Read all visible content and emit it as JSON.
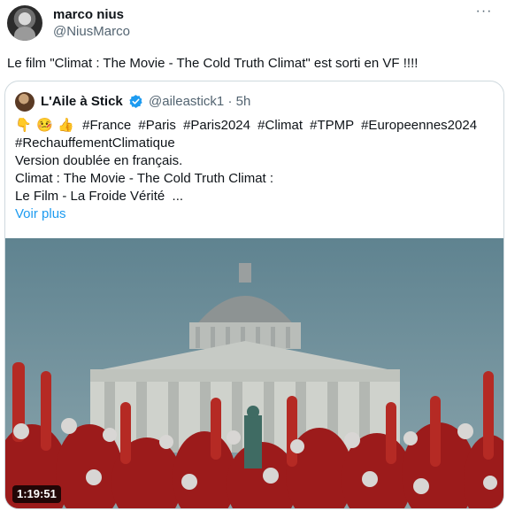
{
  "tweet": {
    "author_name": "marco nius",
    "author_handle": "@NiusMarco",
    "more_icon": "ellipsis-icon",
    "text": "Le film \"Climat : The Movie - The Cold Truth Climat\" est sorti en VF !!!!"
  },
  "quote": {
    "author_name": "L'Aile à Stick",
    "author_handle": "@aileastick1",
    "time": "· 5h",
    "verified_color": "#1d9bf0",
    "emojis": [
      "👇",
      "🤒",
      "👍"
    ],
    "hashtags_line1": [
      "#France",
      "#Paris",
      "#Paris2024",
      "#Climat",
      "#TPMP",
      "#Europeennes2024"
    ],
    "hashtag_line2": "#RechauffementClimatique",
    "line3": "Version doublée en français.",
    "line4": "Climat : The Movie - The Cold Truth Climat :",
    "line5": "Le Film - La Froide Vérité  ...",
    "show_more": "Voir plus",
    "video_duration": "1:19:51"
  }
}
